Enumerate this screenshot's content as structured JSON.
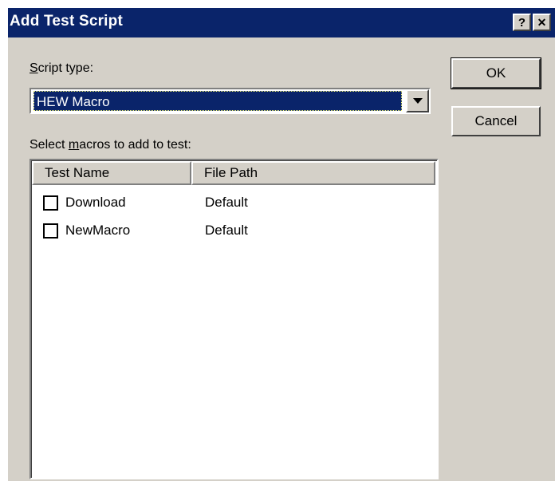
{
  "dialog": {
    "title": "Add Test Script",
    "help_button": "?",
    "close_button": "✕"
  },
  "script_type": {
    "label": "Script type:",
    "value": "HEW Macro"
  },
  "buttons": {
    "ok": "OK",
    "cancel": "Cancel"
  },
  "macros": {
    "label": "Select macros to add to test:",
    "columns": [
      "Test Name",
      "File Path"
    ],
    "rows": [
      {
        "name": "Download",
        "path": "Default",
        "checked": false
      },
      {
        "name": "NewMacro",
        "path": "Default",
        "checked": false
      }
    ]
  }
}
